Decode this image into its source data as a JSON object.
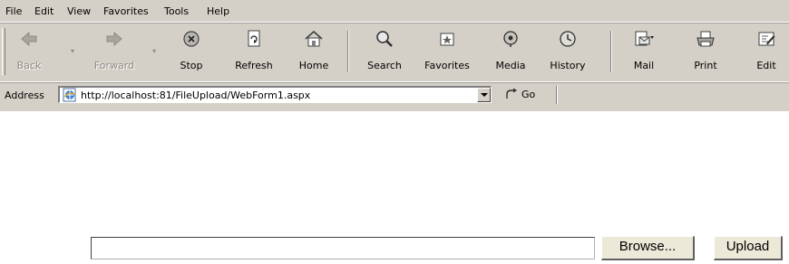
{
  "menu": [
    "File",
    "Edit",
    "View",
    "Favorites",
    "Tools",
    "Help"
  ],
  "toolbar": {
    "back": "Back",
    "forward": "Forward",
    "stop": "Stop",
    "refresh": "Refresh",
    "home": "Home",
    "search": "Search",
    "favorites": "Favorites",
    "media": "Media",
    "history": "History",
    "mail": "Mail",
    "print": "Print",
    "edit": "Edit"
  },
  "address": {
    "label": "Address",
    "url": "http://localhost:81/FileUpload/WebForm1.aspx",
    "go": "Go"
  },
  "form": {
    "file_value": "",
    "browse": "Browse...",
    "upload": "Upload"
  },
  "icons": {
    "back": "back-arrow-icon",
    "forward": "forward-arrow-icon",
    "stop": "stop-icon",
    "refresh": "refresh-icon",
    "home": "home-icon",
    "search": "search-icon",
    "favorites": "favorites-icon",
    "media": "media-icon",
    "history": "history-icon",
    "mail": "mail-icon",
    "print": "print-icon",
    "edit": "edit-icon",
    "page": "ie-page-icon",
    "go": "go-arrow-icon"
  }
}
